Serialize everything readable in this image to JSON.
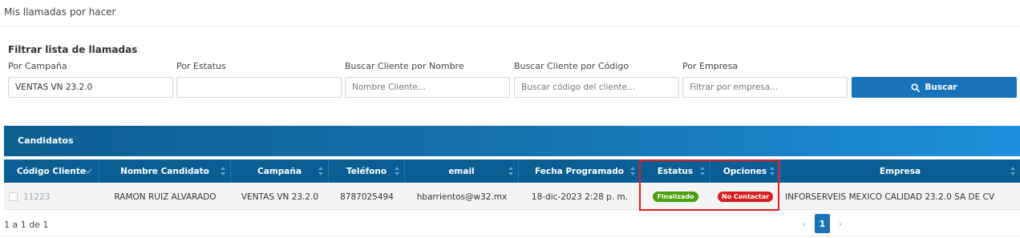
{
  "page": {
    "title": "Mis llamadas por hacer"
  },
  "filters": {
    "heading": "Filtrar lista de llamadas",
    "campaign": {
      "label": "Por Campaña",
      "value": "VENTAS VN 23.2.0",
      "placeholder": ""
    },
    "status": {
      "label": "Por Estatus",
      "value": "",
      "placeholder": ""
    },
    "client_name": {
      "label": "Buscar Cliente por Nombre",
      "value": "",
      "placeholder": "Nombre Cliente..."
    },
    "client_code": {
      "label": "Buscar Cliente por Código",
      "value": "",
      "placeholder": "Buscar código del cliente..."
    },
    "company": {
      "label": "Por Empresa",
      "value": "",
      "placeholder": "Filtrar por empresa..."
    },
    "search_button": {
      "label": "Buscar",
      "icon": "search-icon"
    }
  },
  "panel": {
    "title": "Candidatos"
  },
  "table": {
    "columns": [
      "Código Cliente",
      "Nombre Candidato",
      "Campaña",
      "Teléfono",
      "email",
      "Fecha Programado",
      "Estatus",
      "Opciones",
      "Empresa"
    ],
    "rows": [
      {
        "code": "11223",
        "name": "RAMON RUIZ ALVARADO",
        "campaign": "VENTAS VN 23.2.0",
        "phone": "8787025494",
        "email": "hbarrientos@w32.mx",
        "scheduled": "18-dic-2023 2:28 p. m.",
        "status": "Finalizado",
        "option": "No Contactar",
        "company": "INFORSERVEIS MEXICO CALIDAD 23.2.0 SA DE CV"
      }
    ]
  },
  "footer": {
    "count": "1 a 1 de 1",
    "pagination": {
      "prev": "‹",
      "current": "1",
      "next": "›"
    }
  },
  "colors": {
    "header_dark": "#0a5e93",
    "accent": "#1a73b8",
    "status_green": "#46a10b",
    "option_red": "#d71f1f",
    "highlight_red": "#e31b1b"
  }
}
